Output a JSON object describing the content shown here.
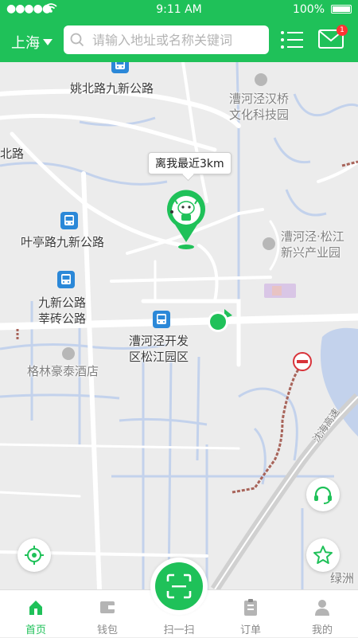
{
  "status_bar": {
    "signal": "●●●●●",
    "time": "9:11 AM",
    "battery": "100%"
  },
  "header": {
    "city": "上海",
    "search_placeholder": "请输入地址或名称关键词",
    "message_badge": "1"
  },
  "map": {
    "distance_tooltip": "离我最近3km",
    "labels": {
      "yaobei": "姚北路九新公路",
      "hanqiao_1": "漕河泾汉桥",
      "hanqiao_2": "文化科技园",
      "beilu": "北路",
      "yeting": "叶亭路九新公路",
      "songjiang_1": "漕河泾·松江",
      "songjiang_2": "新兴产业园",
      "xinzhuan_1": "九新公路",
      "xinzhuan_2": "莘砖公路",
      "kaifa_1": "漕河泾开发",
      "kaifa_2": "区松江园区",
      "hotel": "格林豪泰酒店",
      "lvzhou": "绿洲",
      "expressway": "沈海高速"
    },
    "colors": {
      "accent": "#1fc159",
      "bus": "#2b88d8",
      "traffic": "#a8645a",
      "water": "#c3d2ec"
    }
  },
  "tabs": [
    {
      "label": "首页",
      "icon": "home-plug-icon",
      "active": true
    },
    {
      "label": "钱包",
      "icon": "wallet-icon",
      "active": false
    },
    {
      "label": "扫一扫",
      "icon": "scan-icon",
      "active": false
    },
    {
      "label": "订单",
      "icon": "order-icon",
      "active": false
    },
    {
      "label": "我的",
      "icon": "user-icon",
      "active": false
    }
  ]
}
